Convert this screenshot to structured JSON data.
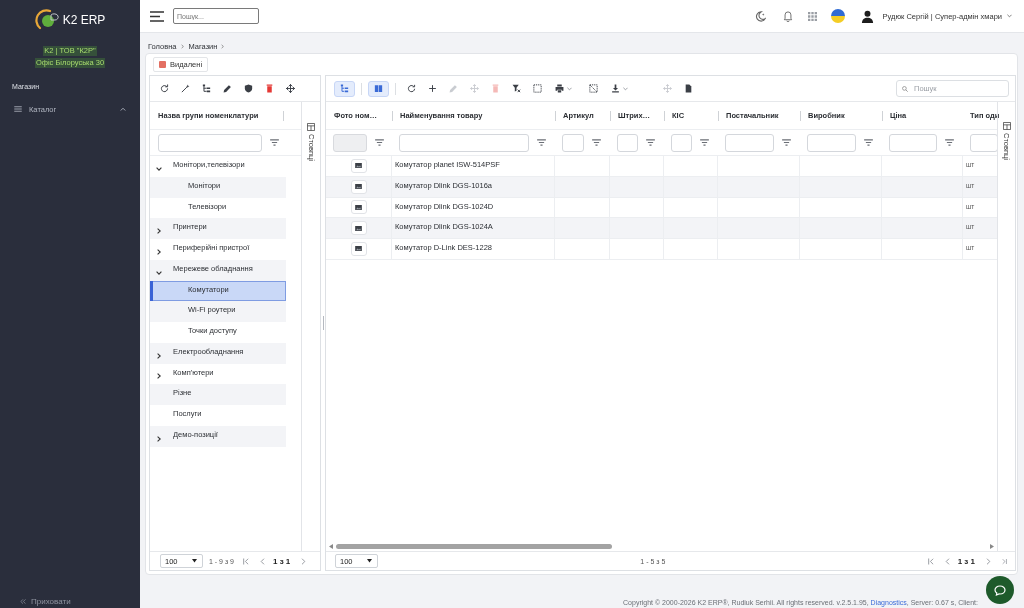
{
  "sidebar": {
    "brand": "K2 ERP",
    "company": "K2 | ТОВ \"К2Р\"",
    "office": "Офіс Білоруська 30",
    "section": "Магазин",
    "items": [
      {
        "label": "Каталог",
        "expanded": true,
        "selected": false
      }
    ],
    "hide_label": "Приховати"
  },
  "topbar": {
    "search": {
      "placeholder": "Пошук..."
    },
    "user": "Рудюк Сергій | Супер-адмін хмари"
  },
  "breadcrumbs": [
    "Головна",
    "Магазин"
  ],
  "deleted_button": "Видалені",
  "category_tree": {
    "column": "Назва групи номенклатури",
    "columns_tab": "Стовпці",
    "items": [
      {
        "label": "Монітори,телевізори",
        "expanded": true,
        "selected": false,
        "children": [
          {
            "label": "Монітори",
            "selected": false
          },
          {
            "label": "Телевізори",
            "selected": false
          }
        ]
      },
      {
        "label": "Принтери",
        "expanded": false,
        "selected": false
      },
      {
        "label": "Периферійні пристрої",
        "expanded": false,
        "selected": false
      },
      {
        "label": "Мережеве обладнання",
        "expanded": true,
        "selected": false,
        "children": [
          {
            "label": "Комутатори",
            "selected": true
          },
          {
            "label": "Wi-Fi роутери",
            "selected": false
          },
          {
            "label": "Точки доступу",
            "selected": false
          }
        ]
      },
      {
        "label": "Електрообладнання",
        "expanded": false,
        "selected": false
      },
      {
        "label": "Комп'ютери",
        "expanded": false,
        "selected": false
      },
      {
        "label": "Різне",
        "selected": false
      },
      {
        "label": "Послуги",
        "selected": false
      },
      {
        "label": "Демо-позиції",
        "expanded": false,
        "selected": false
      }
    ],
    "pagination": {
      "page_size": "100",
      "range": "1 - 9 з 9",
      "page": "1 з 1"
    }
  },
  "product_grid": {
    "toolbar": {
      "toggles": [
        {
          "selected": true
        },
        {
          "selected": true
        }
      ],
      "actions": [
        {
          "disabled": false
        },
        {
          "disabled": false
        },
        {
          "disabled": true
        },
        {
          "disabled": true
        },
        {
          "disabled": true
        },
        {
          "disabled": false
        },
        {
          "disabled": false
        },
        {
          "disabled": false
        },
        {
          "disabled": false
        },
        {
          "disabled": false
        },
        {
          "disabled": true
        },
        {
          "disabled": false
        }
      ],
      "search": {
        "placeholder": "Пошук"
      }
    },
    "columns_tab": "Стовпці",
    "columns": [
      {
        "label": "Фото ном…",
        "filter_disabled": true
      },
      {
        "label": "Найменування товару",
        "filter_disabled": false
      },
      {
        "label": "Артикул",
        "filter_disabled": false
      },
      {
        "label": "Штрих…",
        "filter_disabled": false
      },
      {
        "label": "КІС",
        "filter_disabled": false
      },
      {
        "label": "Постачальник",
        "filter_disabled": false
      },
      {
        "label": "Виробник",
        "filter_disabled": false
      },
      {
        "label": "Ціна",
        "filter_disabled": false
      },
      {
        "label": "Тип оди",
        "filter_disabled": false
      }
    ],
    "rows": [
      {
        "name": "Комутатор planet ISW-514PSF",
        "unit": "шт",
        "selected": false
      },
      {
        "name": "Комутатор Dlink DGS-1016a",
        "unit": "шт",
        "selected": false
      },
      {
        "name": "Комутатор Dlink DGS-1024D",
        "unit": "шт",
        "selected": false
      },
      {
        "name": "Комутатор Dlink DGS-1024A",
        "unit": "шт",
        "selected": false
      },
      {
        "name": "Комутатор D-Link DES-1228",
        "unit": "шт",
        "selected": false
      }
    ],
    "pagination": {
      "page_size": "100",
      "range": "1 - 5 з 5",
      "page": "1 з 1"
    }
  },
  "footer": {
    "text": "Copyright © 2000-2026 K2 ERP®, Rudiuk Serhii. All rights reserved. v.2.5.1.95, ",
    "link": "Diagnostics",
    "text_after": ", Server: 0.67 s, Client:"
  }
}
